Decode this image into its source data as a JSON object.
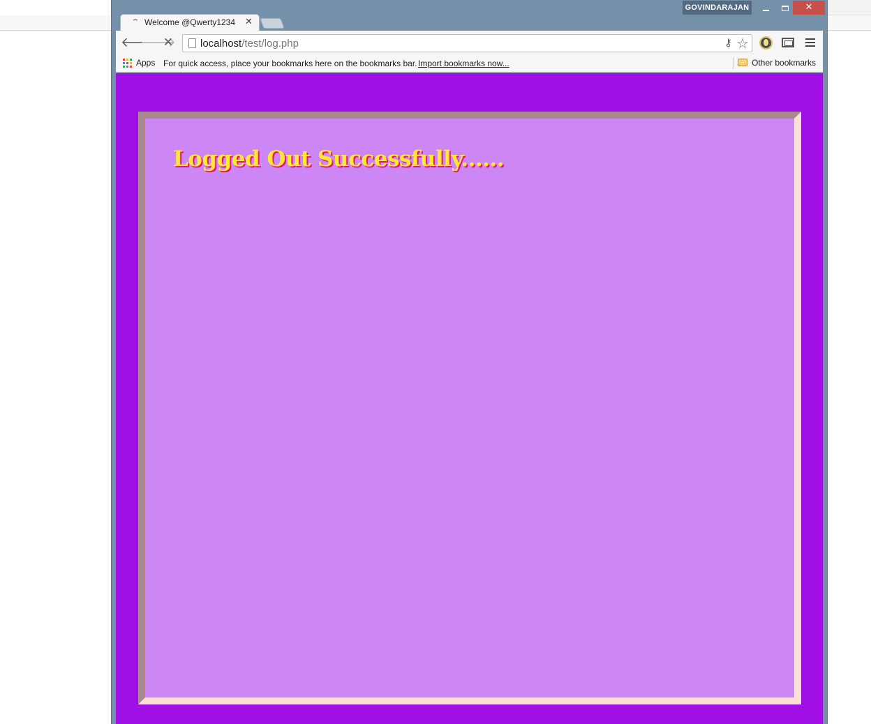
{
  "window": {
    "profile_name": "GOVINDARAJAN",
    "minimize_glyph": "",
    "maximize_glyph": "",
    "close_glyph": "✕"
  },
  "tab": {
    "title": "Welcome @Qwerty1234",
    "close_glyph": "✕"
  },
  "toolbar": {
    "back_glyph": "🡐",
    "forward_glyph": "🡒",
    "stop_glyph": "✕",
    "url_host": "localhost",
    "url_path": "/test/log.php",
    "star_glyph": "☆",
    "key_glyph": "⚷"
  },
  "bookmarks": {
    "apps_label": "Apps",
    "hint": "For quick access, place your bookmarks here on the bookmarks bar.",
    "import_link": "Import bookmarks now...",
    "other_label": "Other bookmarks",
    "apps_icon_colors": [
      "#e94235",
      "#fbbc04",
      "#34a853",
      "#4285f4",
      "#e94235",
      "#fbbc04",
      "#34a853",
      "#4285f4",
      "#e94235"
    ]
  },
  "page": {
    "heading": "Logged Out Successfully......",
    "background_color": "#a010e4",
    "panel_color": "#cc87f4",
    "heading_color": "#ffe733",
    "heading_shadow_color": "#e0177a"
  }
}
